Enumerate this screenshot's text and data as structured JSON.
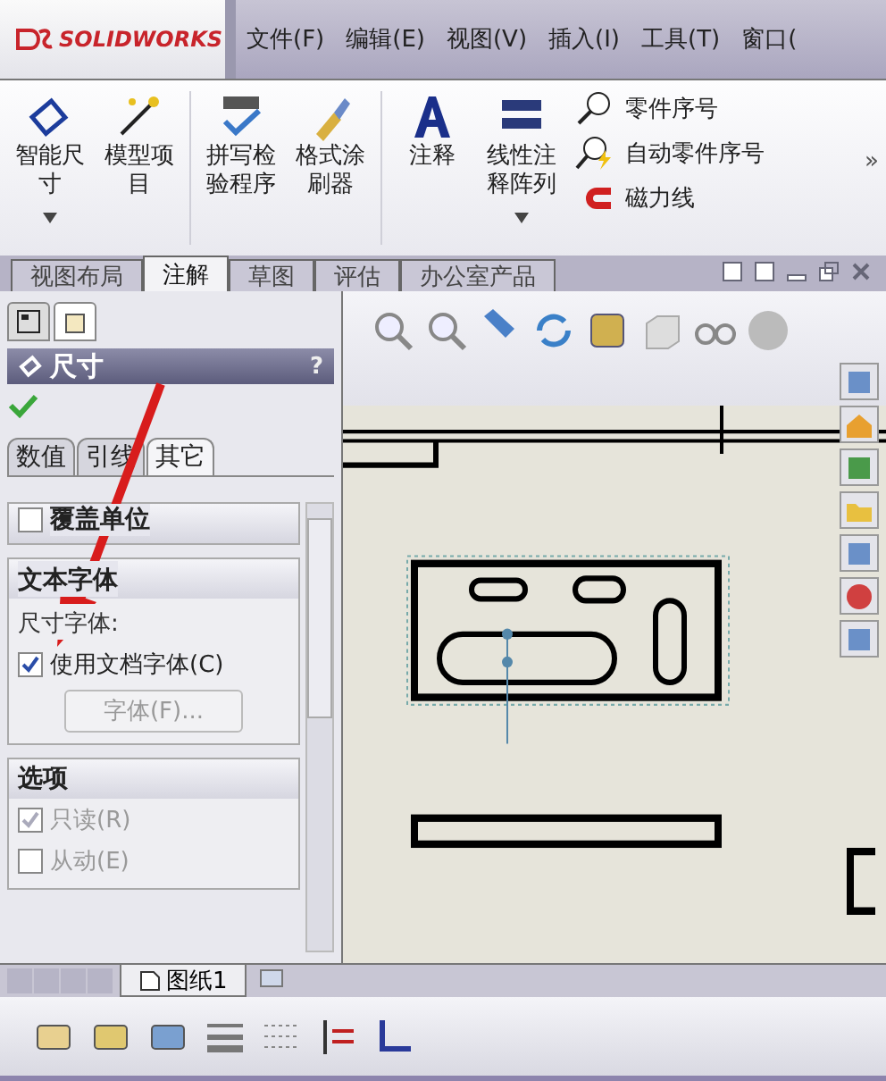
{
  "app": {
    "brand": "SOLIDWORKS"
  },
  "menu": [
    "文件(F)",
    "编辑(E)",
    "视图(V)",
    "插入(I)",
    "工具(T)",
    "窗口("
  ],
  "ribbon": {
    "large": [
      {
        "label": "智能尺寸",
        "kind": "dimension",
        "dropdown": true
      },
      {
        "label": "模型项目",
        "kind": "model",
        "dropdown": false
      },
      {
        "label": "拼写检验程序",
        "kind": "spell",
        "dropdown": false
      },
      {
        "label": "格式涂刷器",
        "kind": "brush",
        "dropdown": false
      },
      {
        "label": "注释",
        "kind": "note",
        "dropdown": false
      },
      {
        "label": "线性注释阵列",
        "kind": "pattern",
        "dropdown": true
      }
    ],
    "small": [
      {
        "label": "零件序号",
        "kind": "balloon"
      },
      {
        "label": "自动零件序号",
        "kind": "autoballoon"
      },
      {
        "label": "磁力线",
        "kind": "magnet"
      }
    ],
    "overflow": "»"
  },
  "tabs": [
    {
      "label": "视图布局",
      "selected": false
    },
    {
      "label": "注解",
      "selected": true
    },
    {
      "label": "草图",
      "selected": false
    },
    {
      "label": "评估",
      "selected": false
    },
    {
      "label": "办公室产品",
      "selected": false
    }
  ],
  "panel": {
    "title": "尺寸",
    "help": "?",
    "subtabs": [
      {
        "label": "数值",
        "selected": false
      },
      {
        "label": "引线",
        "selected": false
      },
      {
        "label": "其它",
        "selected": true
      }
    ],
    "override": {
      "label": "覆盖单位",
      "checked": false
    },
    "font_group": {
      "title": "文本字体",
      "label": "尺寸字体:",
      "checkbox": {
        "label": "使用文档字体(C)",
        "checked": true
      },
      "button": {
        "label": "字体(F)...",
        "disabled": true
      }
    },
    "options": {
      "title": "选项",
      "items": [
        {
          "label": "只读(R)",
          "checked": true,
          "disabled": true
        },
        {
          "label": "从动(E)",
          "checked": false,
          "disabled": true
        }
      ]
    }
  },
  "sheet_tabs": [
    {
      "label": "图纸1",
      "selected": true
    }
  ]
}
